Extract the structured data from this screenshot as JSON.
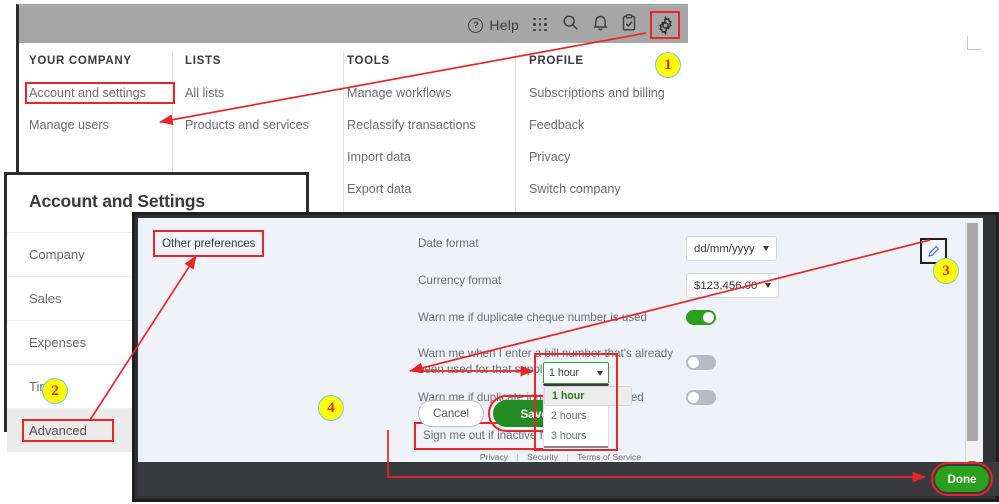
{
  "app": {
    "topbar": {
      "help_label": "Help",
      "icons": [
        "question-circle-icon",
        "grid-apps-icon",
        "search-icon",
        "bell-notification-icon",
        "clipboard-check-icon",
        "gear-settings-icon"
      ]
    },
    "gear_menu": {
      "columns": [
        {
          "heading": "YOUR COMPANY",
          "items": [
            "Account and settings",
            "Manage users"
          ]
        },
        {
          "heading": "LISTS",
          "items": [
            "All lists",
            "Products and services"
          ]
        },
        {
          "heading": "TOOLS",
          "items": [
            "Manage workflows",
            "Reclassify transactions",
            "Import data",
            "Export data"
          ]
        },
        {
          "heading": "PROFILE",
          "items": [
            "Subscriptions and billing",
            "Feedback",
            "Privacy",
            "Switch company"
          ]
        }
      ]
    }
  },
  "account_settings_panel": {
    "title": "Account and Settings",
    "nav": [
      {
        "label": "Company",
        "selected": false
      },
      {
        "label": "Sales",
        "selected": false
      },
      {
        "label": "Expenses",
        "selected": false
      },
      {
        "label": "Time",
        "selected": false
      },
      {
        "label": "Advanced",
        "selected": true
      }
    ]
  },
  "settings_dialog": {
    "section_tab": "Other preferences",
    "edit_icon": "pencil-edit-icon",
    "rows": [
      {
        "label": "Date format",
        "control": "select",
        "value": "dd/mm/yyyy"
      },
      {
        "label": "Currency format",
        "control": "select",
        "value": "$123,456.00"
      },
      {
        "label": "Warn me if duplicate cheque number is used",
        "control": "toggle",
        "value": "on"
      },
      {
        "label": "Warn me when I enter a bill number that's already been used for that supplier",
        "control": "toggle",
        "value": "off"
      },
      {
        "label": "Warn me if duplicate journal number is used",
        "control": "toggle",
        "value": "off"
      },
      {
        "label": "Sign me out if inactive for",
        "control": "dropdown",
        "value": "1 hour"
      }
    ],
    "buttons": {
      "cancel": "Cancel",
      "save": "Save",
      "done": "Done"
    },
    "inactive_dropdown": {
      "selected": "1 hour",
      "options": [
        "1 hour",
        "2 hours",
        "3 hours"
      ]
    },
    "legal": {
      "privacy": "Privacy",
      "security": "Security",
      "terms": "Terms of Service",
      "separator": "|"
    }
  },
  "callouts": [
    {
      "number": "1"
    },
    {
      "number": "2"
    },
    {
      "number": "3"
    },
    {
      "number": "4"
    }
  ],
  "colors": {
    "accent_green": "#2ca01c",
    "save_green": "#228b22",
    "annotation_red": "#e8262a",
    "badge_yellow": "#ffff00",
    "topbar_gray": "#a6a6a6",
    "dialog_bg": "#eff3f9",
    "footer_dark": "#393a3d"
  }
}
